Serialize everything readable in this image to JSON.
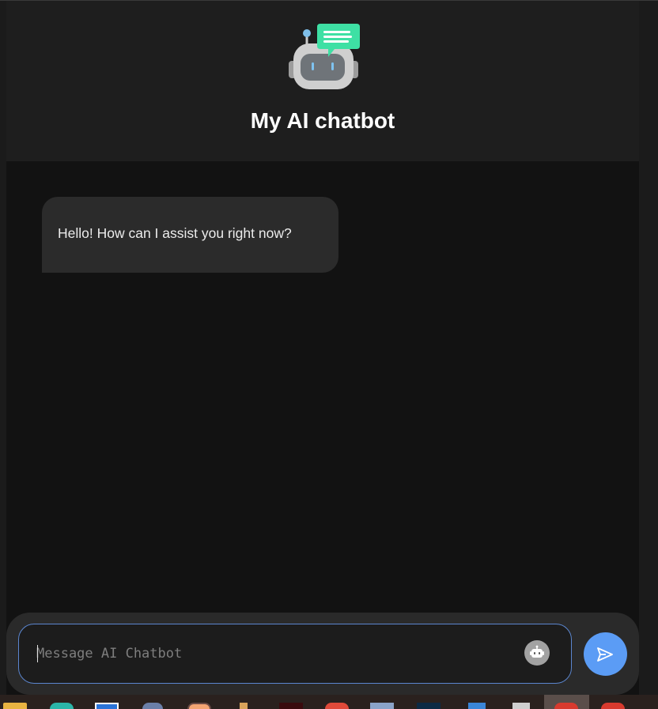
{
  "header": {
    "title": "My AI chatbot",
    "logo_icon": "robot-chat-icon"
  },
  "messages": [
    {
      "role": "bot",
      "text": "Hello! How can I assist you right now?"
    }
  ],
  "composer": {
    "placeholder": "Message AI Chatbot",
    "value": "",
    "bot_icon": "robot-icon",
    "send_icon": "send-icon"
  },
  "taskbar": {
    "icons": [
      "folder-icon",
      "chrome-icon",
      "app-icon",
      "people-icon",
      "app-icon",
      "pencil-icon",
      "app-icon",
      "app-icon",
      "app-icon",
      "app-icon",
      "app-icon",
      "app-icon",
      "app-icon",
      "app-icon"
    ]
  },
  "colors": {
    "background": "#121212",
    "header": "#1e1e1e",
    "bubble": "#2b2b2b",
    "accent": "#5b9cf5",
    "input_border": "#5b86cf",
    "logo_green": "#3ee0a4"
  }
}
